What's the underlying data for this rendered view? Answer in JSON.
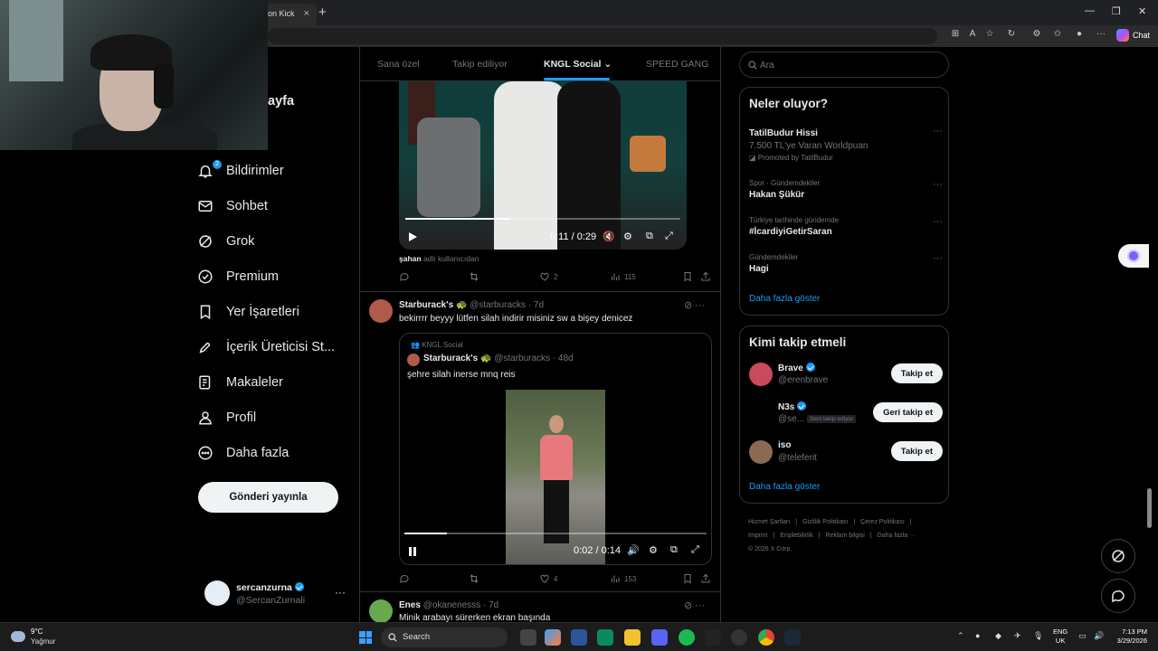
{
  "browser": {
    "tab_title": "on Kick",
    "tab_close": "×",
    "new_tab": "+",
    "minimize": "—",
    "restore": "❐",
    "close": "✕",
    "chat_label": "Chat"
  },
  "nav": {
    "home_fragment": "ayfa",
    "items": [
      {
        "label": "Bildirimler",
        "icon": "bell-icon",
        "badge": "2"
      },
      {
        "label": "Sohbet",
        "icon": "envelope-icon"
      },
      {
        "label": "Grok",
        "icon": "grok-icon"
      },
      {
        "label": "Premium",
        "icon": "premium-icon"
      },
      {
        "label": "Yer İşaretleri",
        "icon": "bookmark-icon"
      },
      {
        "label": "İçerik Üreticisi St...",
        "icon": "rocket-icon"
      },
      {
        "label": "Makaleler",
        "icon": "article-icon"
      },
      {
        "label": "Profil",
        "icon": "person-icon"
      },
      {
        "label": "Daha fazla",
        "icon": "more-circle-icon"
      }
    ],
    "post_button": "Gönderi yayınla",
    "account": {
      "name": "sercanzurna",
      "handle": "@SercanZurnali",
      "more": "···"
    }
  },
  "timeline": {
    "tabs": [
      "Sana özel",
      "Takip ediliyor",
      "KNGL Social",
      "SPEED GANG"
    ],
    "active_tab": "KNGL Social",
    "post1": {
      "video_time": "0:11 / 0:29",
      "video_progress": 0.38,
      "byline_user": "şahan",
      "byline_rest": " adlı kullanıcıdan",
      "replies": "",
      "reposts": "",
      "likes": "2",
      "views": "115"
    },
    "post2": {
      "name": "Starburack's 🐢",
      "handle": "@starburacks · 7d",
      "more": "···",
      "text": "bekirrrr beyyy lütfen silah indirir misiniz sw a bişey denicez",
      "quote": {
        "community": "KNGL Social",
        "name": "Starburack's 🐢",
        "handle": "@starburacks · 48d",
        "text": "şehre silah inerse mnq reis",
        "video_time": "0:02 / 0:14",
        "video_progress": 0.14
      },
      "replies": "",
      "reposts": "",
      "likes": "4",
      "views": "153"
    },
    "post3": {
      "name": "Enes",
      "handle": "@okanenesss · 7d",
      "more": "···",
      "text": "Minik arabayı sürerken ekran başında"
    }
  },
  "sidebar": {
    "search_placeholder": "Ara",
    "trends_title": "Neler oluyor?",
    "trends": [
      {
        "category": "",
        "name": "TatilBudur Hissi",
        "sub": "7.500 TL'ye Varan Worldpuan",
        "promo": "Promoted by TatilBudur"
      },
      {
        "category": "Spor · Gündemdekiler",
        "name": "Hakan Şükür",
        "sub": "",
        "promo": ""
      },
      {
        "category": "Türkiye tarihinde gündemde",
        "name": "#İcardiyiGetirSaran",
        "sub": "",
        "promo": ""
      },
      {
        "category": "Gündemdekiler",
        "name": "Hagi",
        "sub": "",
        "promo": ""
      }
    ],
    "trend_more": "···",
    "trends_show_more": "Daha fazla göster",
    "follow_title": "Kimi takip etmeli",
    "follows": [
      {
        "name": "Brave",
        "handle": "@erenbrave",
        "tag": "",
        "button": "Takip et"
      },
      {
        "name": "N3s",
        "handle": "@se...",
        "tag": "Seni takip ediyor",
        "button": "Geri takip et"
      },
      {
        "name": "iso",
        "handle": "@teleferit",
        "tag": "",
        "button": "Takip et"
      }
    ],
    "follow_show_more": "Daha fazla göster",
    "footer_line1": [
      "Hizmet Şartları",
      "|",
      "Gizlilik Politikası",
      "|",
      "Çerez Politikası",
      "|"
    ],
    "footer_line2": [
      "Imprint",
      "|",
      "Erişilebilirlik",
      "|",
      "Reklam bilgisi",
      "|",
      "Daha fazla ···"
    ],
    "footer_copyright": "© 2026 X Corp."
  },
  "taskbar": {
    "temp": "9°C",
    "weather": "Yağmur",
    "search_label": "Search",
    "lang1": "ENG",
    "lang2": "UK",
    "time": "7:13 PM",
    "date": "3/29/2026"
  },
  "colors": {
    "accent": "#1d9bf0",
    "background": "#000000",
    "border": "#2f3336",
    "muted": "#71767b"
  }
}
